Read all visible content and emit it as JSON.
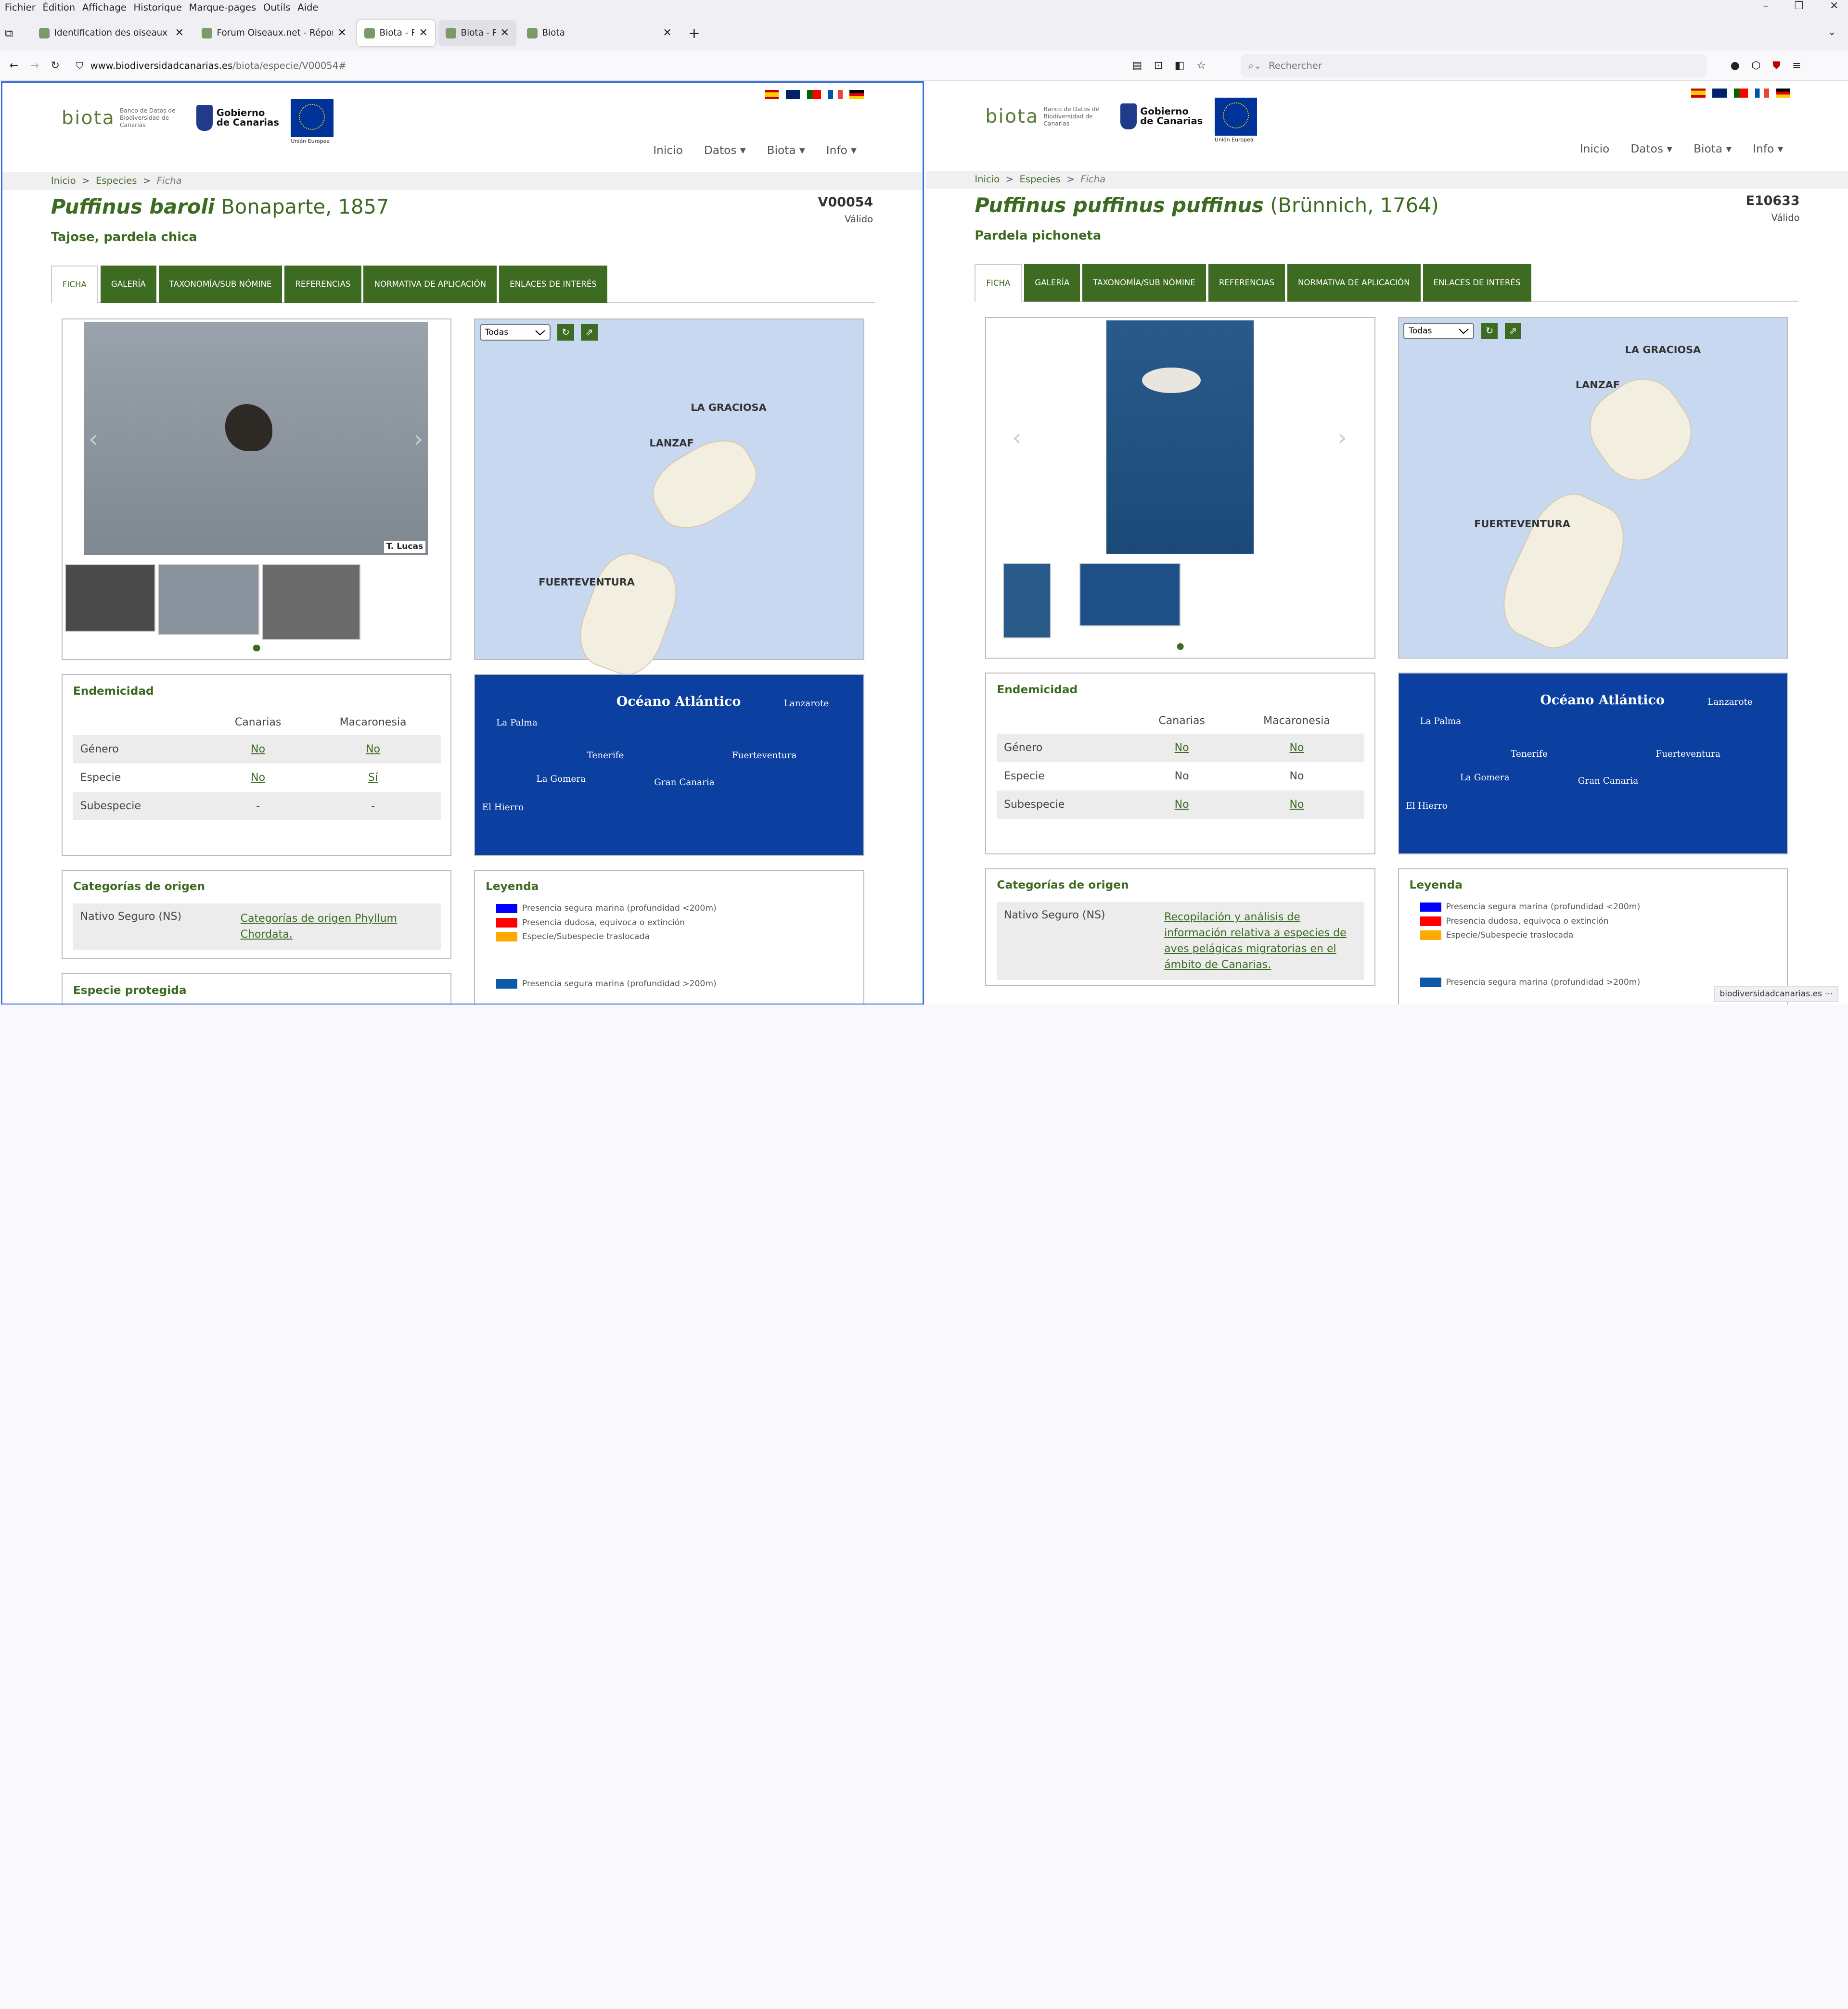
{
  "menubar": [
    "Fichier",
    "Édition",
    "Affichage",
    "Historique",
    "Marque-pages",
    "Outils",
    "Aide"
  ],
  "tabs": [
    {
      "label": "Identification des oiseaux d'Eur"
    },
    {
      "label": "Forum Oiseaux.net - Répondre"
    },
    {
      "label": "Biota - Pu"
    },
    {
      "label": "Biota - Pu"
    },
    {
      "label": "Biota"
    }
  ],
  "url": {
    "host": "www.biodiversidadcanarias.es",
    "path": "/biota/especie/V00054#"
  },
  "search_placeholder": "Rechercher",
  "site": {
    "biota_text": "Banco de Datos de Biodiversidad de Canarias",
    "gob_line1": "Gobierno",
    "gob_line2": "de Canarias",
    "eu": "Unión Europea",
    "nav": [
      "Inicio",
      "Datos ▾",
      "Biota ▾",
      "Info ▾"
    ],
    "crumb": [
      "Inicio",
      ">",
      "Especies",
      ">",
      "Ficha"
    ],
    "tabs": [
      "FICHA",
      "GALERÍA",
      "TAXONOMÍA/SUB NÓMINE",
      "REFERENCIAS",
      "NORMATIVA DE APLICACIÓN",
      "ENLACES DE INTERÉS"
    ],
    "map_select": "Todas",
    "endemicity_title": "Endemicidad",
    "col_canarias": "Canarias",
    "col_macaronesia": "Macaronesia",
    "origin_title": "Categorías de origen",
    "legend_title": "Leyenda",
    "ocean": "Océano Atlántico"
  },
  "left": {
    "genus": "Puffinus baroli",
    "author": "Bonaparte, 1857",
    "code": "V00054",
    "status": "Válido",
    "common": "Tajose, pardela chica",
    "credit": "T. Lucas",
    "rows": [
      {
        "name": "Género",
        "c": "No",
        "m": "No"
      },
      {
        "name": "Especie",
        "c": "No",
        "m": "Sí"
      },
      {
        "name": "Subespecie",
        "c": "-",
        "m": "-"
      }
    ],
    "origin_cat": "Nativo Seguro (NS)",
    "origin_link": "Categorías de origen Phyllum Chordata.",
    "protected_title": "Especie protegida"
  },
  "right": {
    "genus": "Puffinus puffinus puffinus",
    "author": "(Brünnich, 1764)",
    "code": "E10633",
    "status": "Válido",
    "common": "Pardela pichoneta",
    "rows": [
      {
        "name": "Género",
        "c": "No",
        "m": "No"
      },
      {
        "name": "Especie",
        "c": "No",
        "m": "No"
      },
      {
        "name": "Subespecie",
        "c": "No",
        "m": "No"
      }
    ],
    "origin_cat": "Nativo Seguro (NS)",
    "origin_link": "Recopilación y análisis de información relativa a especies de aves pelágicas migratorias en el ámbito de Canarias."
  },
  "map_labels": {
    "lanzarote": "LANZAF",
    "graciosa": "LA GRACIOSA",
    "graciosa_left": "LA GRACIOSA",
    "fuerte": "FUERTEVENTURA"
  },
  "sea_labels": [
    "La Palma",
    "Tenerife",
    "La Gomera",
    "Gran Canaria",
    "Fuerteventura",
    "Lanzarote",
    "El Hierro"
  ],
  "legend": [
    {
      "color": "#0000ff",
      "text": "Presencia segura marina (profundidad <200m)"
    },
    {
      "color": "#ff0000",
      "text": "Presencia dudosa, equivoca o extinción"
    },
    {
      "color": "#ffaa00",
      "text": "Especie/Subespecie traslocada"
    },
    {
      "color": "#0a5aa8",
      "text": "Presencia segura marina (profundidad >200m)"
    }
  ],
  "status_url": "biodiversidadcanarias.es"
}
